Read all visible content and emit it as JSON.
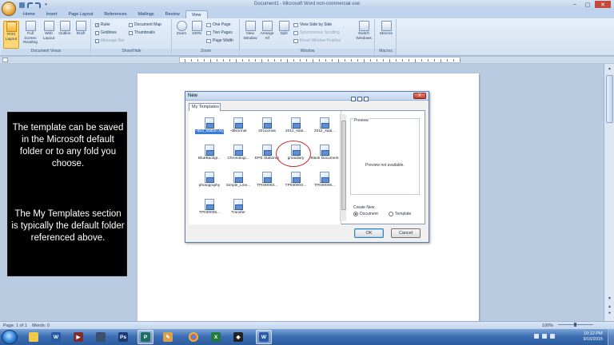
{
  "window": {
    "title": "Document1 - Microsoft Word non-commercial use"
  },
  "ribbon_tabs": [
    "Home",
    "Insert",
    "Page Layout",
    "References",
    "Mailings",
    "Review",
    "View"
  ],
  "active_tab": "View",
  "ribbon": {
    "document_views": {
      "label": "Document Views",
      "buttons": [
        "Print Layout",
        "Full Screen Reading",
        "Web Layout",
        "Outline",
        "Draft"
      ]
    },
    "show_hide": {
      "label": "Show/Hide",
      "ruler": "Ruler",
      "gridlines": "Gridlines",
      "message_bar": "Message Bar",
      "document_map": "Document Map",
      "thumbnails": "Thumbnails"
    },
    "zoom": {
      "label": "Zoom",
      "zoom": "Zoom",
      "percent": "100%",
      "one_page": "One Page",
      "two_pages": "Two Pages",
      "page_width": "Page Width"
    },
    "window": {
      "label": "Window",
      "new_window": "New Window",
      "arrange_all": "Arrange All",
      "split": "Split",
      "view_side_by_side": "View Side by Side",
      "sync_scrolling": "Synchronous Scrolling",
      "reset_position": "Reset Window Position",
      "switch_windows": "Switch Windows"
    },
    "macros": {
      "label": "Macros",
      "button": "Macros"
    }
  },
  "panel": {
    "paragraph1": "The template can be saved in the Microsoft default folder or to any fold you choose.",
    "paragraph2": "The My Templates section is typically the default folder referenced above."
  },
  "dialog": {
    "title": "New",
    "close": "X",
    "tab": "My Templates",
    "templates": [
      {
        "label": "~$12_station ary",
        "selected": true
      },
      {
        "label": "~$Normal"
      },
      {
        "label": "2011xmas"
      },
      {
        "label": "2012_stati..."
      },
      {
        "label": "2012_stati..."
      },
      {
        "label": "BlueBackgr..."
      },
      {
        "label": "Chronologi..."
      },
      {
        "label": "DPE Stationar"
      },
      {
        "label": "gmaidiary"
      },
      {
        "label": "Blank Document"
      },
      {
        "label": "photography"
      },
      {
        "label": "Simple_Line..."
      },
      {
        "label": "TP030003..."
      },
      {
        "label": "TP03000S..."
      },
      {
        "label": "TP030006..."
      },
      {
        "label": "TP030006..."
      },
      {
        "label": "Transfer"
      }
    ],
    "preview_label": "Preview",
    "preview_text": "Preview not available.",
    "create_new": "Create New",
    "radio_document": "Document",
    "radio_template": "Template",
    "ok": "OK",
    "cancel": "Cancel"
  },
  "statusbar": {
    "page": "Page: 1 of 1",
    "words": "Words: 0",
    "zoom": "100%"
  },
  "taskbar": {
    "apps": [
      "Explorer",
      "Word",
      "Media",
      "Photoshop",
      "Publisher",
      "PowerPoint",
      "Paint",
      "Chrome",
      "Excel",
      "Inkscape",
      "Unity",
      "Word doc"
    ],
    "time": "10:12 PM",
    "date": "9/16/2015"
  },
  "colors": {
    "accent": "#3a7bd5",
    "annotation_ring": "#c8232c",
    "panel_bg": "#000000"
  }
}
